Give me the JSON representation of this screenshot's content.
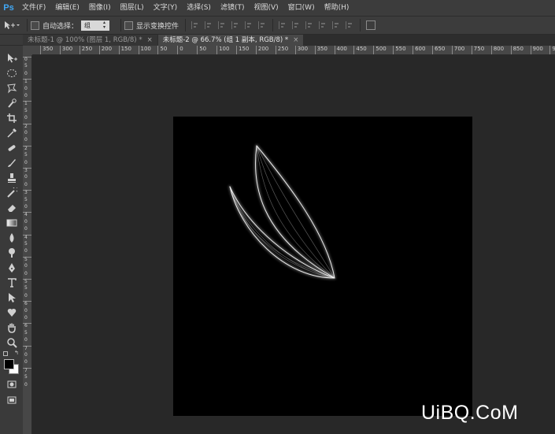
{
  "app": {
    "logo": "Ps"
  },
  "menu": [
    "文件(F)",
    "编辑(E)",
    "图像(I)",
    "图层(L)",
    "文字(Y)",
    "选择(S)",
    "滤镜(T)",
    "视图(V)",
    "窗口(W)",
    "帮助(H)"
  ],
  "options": {
    "auto_select_label": "自动选择：",
    "auto_select_value": "组",
    "show_transform_label": "显示变换控件"
  },
  "tabs": [
    {
      "title": "未标题-1 @ 100% (图层 1, RGB/8) *",
      "close": "×",
      "active": false
    },
    {
      "title": "未标题-2 @ 66.7% (组 1 副本, RGB/8) *",
      "close": "×",
      "active": true
    }
  ],
  "ruler": {
    "top": [
      "350",
      "300",
      "250",
      "200",
      "150",
      "100",
      "50",
      "0",
      "50",
      "100",
      "150",
      "200",
      "250",
      "300",
      "350",
      "400",
      "450",
      "500",
      "550",
      "600",
      "650",
      "700",
      "750",
      "800",
      "850",
      "900",
      "95"
    ],
    "left": [
      "0",
      "5",
      "0",
      "1",
      "0",
      "0",
      "1",
      "5",
      "0",
      "2",
      "0",
      "0",
      "2",
      "5",
      "0",
      "3",
      "0",
      "0",
      "3",
      "5",
      "0",
      "4",
      "0",
      "0",
      "4",
      "5",
      "0",
      "5",
      "0",
      "0",
      "5",
      "5",
      "0",
      "6",
      "0",
      "0",
      "6",
      "5",
      "0",
      "7",
      "0",
      "0",
      "7",
      "5",
      "0"
    ]
  },
  "colors": {
    "foreground": "#000000",
    "background": "#ffffff",
    "canvas": "#000000"
  },
  "watermark": "UiBQ.CoM"
}
